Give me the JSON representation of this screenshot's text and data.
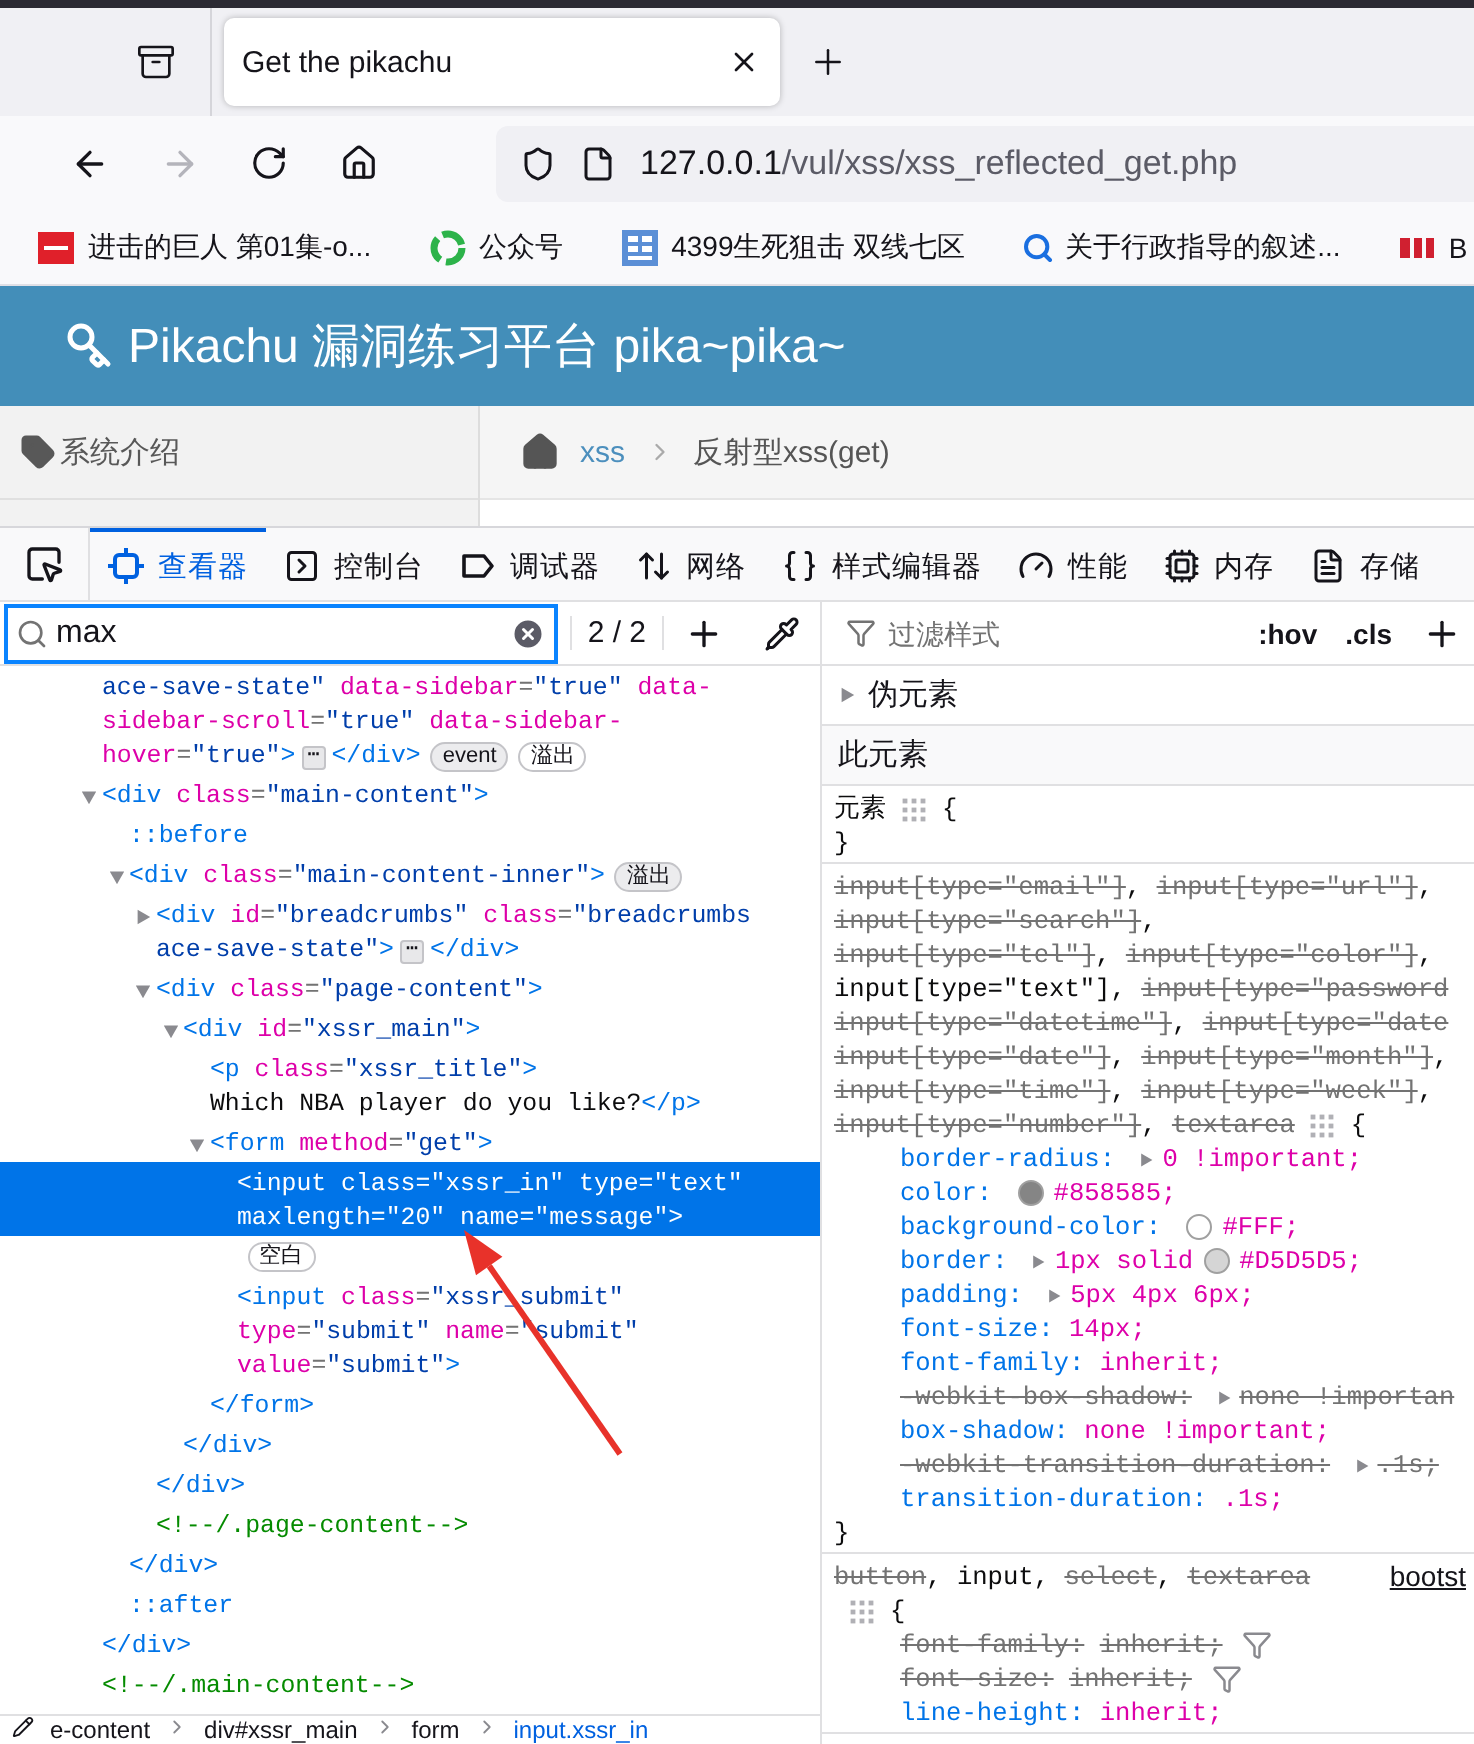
{
  "browser": {
    "tab": {
      "title": "Get the pikachu",
      "selected": true
    },
    "url": {
      "host": "127.0.0.1",
      "path": "/vul/xss/xss_reflected_get.php"
    },
    "forward_disabled": true,
    "bookmarks": [
      {
        "kind": "video",
        "label": "进击的巨人 第01集-o..."
      },
      {
        "kind": "ring",
        "label": "公众号"
      },
      {
        "kind": "grid",
        "label": "4399生死狙击 双线七区"
      },
      {
        "kind": "search",
        "label": "关于行政指导的叙述..."
      },
      {
        "kind": "logo",
        "label": "B"
      }
    ]
  },
  "page": {
    "title": "Pikachu 漏洞练习平台 pika~pika~",
    "sidebar_item": "系统介绍",
    "breadcrumb": [
      {
        "label": "xss",
        "link": true
      },
      {
        "label": "反射型xss(get)",
        "link": false
      }
    ]
  },
  "devtools": {
    "tabs": [
      {
        "label": "查看器",
        "selected": true
      },
      {
        "label": "控制台",
        "selected": false
      },
      {
        "label": "调试器",
        "selected": false
      },
      {
        "label": "网络",
        "selected": false
      },
      {
        "label": "样式编辑器",
        "selected": false
      },
      {
        "label": "性能",
        "selected": false
      },
      {
        "label": "内存",
        "selected": false
      },
      {
        "label": "存储",
        "selected": false
      }
    ],
    "search": {
      "value": "max",
      "count": "2 / 2"
    },
    "markup": [
      {
        "selected": false,
        "lines": [
          [
            {
              "kind": "value",
              "text": "ace-save-state\""
            },
            {
              "kind": "attr",
              "text": " data-sidebar"
            },
            {
              "kind": "punct",
              "text": "="
            },
            {
              "kind": "value",
              "text": "\"true\""
            },
            {
              "kind": "attr",
              "text": " data-"
            }
          ],
          [
            {
              "kind": "attr",
              "text": "sidebar-scroll"
            },
            {
              "kind": "punct",
              "text": "="
            },
            {
              "kind": "value",
              "text": "\"true\""
            },
            {
              "kind": "attr",
              "text": " data-sidebar-"
            }
          ],
          [
            {
              "kind": "attr",
              "text": "hover"
            },
            {
              "kind": "punct",
              "text": "="
            },
            {
              "kind": "value",
              "text": "\"true\""
            },
            {
              "kind": "tag",
              "text": ">"
            },
            {
              "kind": "ellipsis",
              "text": "⋯"
            },
            {
              "kind": "tag",
              "text": "</div>"
            },
            {
              "kind": "badge",
              "text": "event"
            },
            {
              "kind": "badge",
              "text": "溢出"
            }
          ]
        ]
      },
      {
        "selected": false,
        "expanded": true,
        "lines": [
          [
            {
              "kind": "tag",
              "text": "<div"
            },
            {
              "kind": "attr",
              "text": " class"
            },
            {
              "kind": "punct",
              "text": "="
            },
            {
              "kind": "value",
              "text": "\"main-content\""
            },
            {
              "kind": "tag",
              "text": ">"
            }
          ]
        ],
        "close": [
          {
            "kind": "tag",
            "text": "</div>"
          }
        ],
        "children": [
          {
            "selected": false,
            "lines": [
              [
                {
                  "kind": "pseudo",
                  "text": "::before"
                }
              ]
            ]
          },
          {
            "selected": false,
            "expanded": true,
            "lines": [
              [
                {
                  "kind": "tag",
                  "text": "<div"
                },
                {
                  "kind": "attr",
                  "text": " class"
                },
                {
                  "kind": "punct",
                  "text": "="
                },
                {
                  "kind": "value",
                  "text": "\"main-content-inner\""
                },
                {
                  "kind": "tag",
                  "text": ">"
                },
                {
                  "kind": "badge",
                  "text": "溢出"
                }
              ]
            ],
            "close": [
              {
                "kind": "tag",
                "text": "</div>"
              }
            ],
            "children": [
              {
                "selected": false,
                "expanded": false,
                "lines": [
                  [
                    {
                      "kind": "tag",
                      "text": "<div"
                    },
                    {
                      "kind": "attr",
                      "text": " id"
                    },
                    {
                      "kind": "punct",
                      "text": "="
                    },
                    {
                      "kind": "value",
                      "text": "\"breadcrumbs\""
                    },
                    {
                      "kind": "attr",
                      "text": " class"
                    },
                    {
                      "kind": "punct",
                      "text": "="
                    },
                    {
                      "kind": "value",
                      "text": "\"breadcrumbs"
                    }
                  ],
                  [
                    {
                      "kind": "value",
                      "text": "ace-save-state\""
                    },
                    {
                      "kind": "tag",
                      "text": ">"
                    },
                    {
                      "kind": "ellipsis",
                      "text": "⋯"
                    },
                    {
                      "kind": "tag",
                      "text": "</div>"
                    }
                  ]
                ]
              },
              {
                "selected": false,
                "expanded": true,
                "lines": [
                  [
                    {
                      "kind": "tag",
                      "text": "<div"
                    },
                    {
                      "kind": "attr",
                      "text": " class"
                    },
                    {
                      "kind": "punct",
                      "text": "="
                    },
                    {
                      "kind": "value",
                      "text": "\"page-content\""
                    },
                    {
                      "kind": "tag",
                      "text": ">"
                    }
                  ]
                ],
                "close": [
                  {
                    "kind": "tag",
                    "text": "</div>"
                  }
                ],
                "children": [
                  {
                    "selected": false,
                    "expanded": true,
                    "lines": [
                      [
                        {
                          "kind": "tag",
                          "text": "<div"
                        },
                        {
                          "kind": "attr",
                          "text": " id"
                        },
                        {
                          "kind": "punct",
                          "text": "="
                        },
                        {
                          "kind": "value",
                          "text": "\"xssr_main\""
                        },
                        {
                          "kind": "tag",
                          "text": ">"
                        }
                      ]
                    ],
                    "close": [
                      {
                        "kind": "tag",
                        "text": "</div>"
                      }
                    ],
                    "children": [
                      {
                        "selected": false,
                        "lines": [
                          [
                            {
                              "kind": "tag",
                              "text": "<p"
                            },
                            {
                              "kind": "attr",
                              "text": " class"
                            },
                            {
                              "kind": "punct",
                              "text": "="
                            },
                            {
                              "kind": "value",
                              "text": "\"xssr_title\""
                            },
                            {
                              "kind": "tag",
                              "text": ">"
                            }
                          ],
                          [
                            {
                              "kind": "text",
                              "text": "Which NBA player do you like?"
                            },
                            {
                              "kind": "tag",
                              "text": "</p>"
                            }
                          ]
                        ]
                      },
                      {
                        "selected": false,
                        "expanded": true,
                        "lines": [
                          [
                            {
                              "kind": "tag",
                              "text": "<form"
                            },
                            {
                              "kind": "attr",
                              "text": " method"
                            },
                            {
                              "kind": "punct",
                              "text": "="
                            },
                            {
                              "kind": "value",
                              "text": "\"get\""
                            },
                            {
                              "kind": "tag",
                              "text": ">"
                            }
                          ]
                        ],
                        "close": [
                          {
                            "kind": "tag",
                            "text": "</form>"
                          }
                        ],
                        "children": [
                          {
                            "selected": true,
                            "lines": [
                              [
                                {
                                  "kind": "tag",
                                  "text": "<input"
                                },
                                {
                                  "kind": "attr",
                                  "text": " class"
                                },
                                {
                                  "kind": "punct",
                                  "text": "="
                                },
                                {
                                  "kind": "value",
                                  "text": "\"xssr_in\""
                                },
                                {
                                  "kind": "attr",
                                  "text": " type"
                                },
                                {
                                  "kind": "punct",
                                  "text": "="
                                },
                                {
                                  "kind": "value",
                                  "text": "\"text\""
                                }
                              ],
                              [
                                {
                                  "kind": "attr",
                                  "text": "maxlength"
                                },
                                {
                                  "kind": "punct",
                                  "text": "="
                                },
                                {
                                  "kind": "value",
                                  "text": "\"20\""
                                },
                                {
                                  "kind": "attr",
                                  "text": " name"
                                },
                                {
                                  "kind": "punct",
                                  "text": "="
                                },
                                {
                                  "kind": "value",
                                  "text": "\"message\""
                                },
                                {
                                  "kind": "tag",
                                  "text": ">"
                                }
                              ]
                            ]
                          },
                          {
                            "selected": false,
                            "lines": [
                              [
                                {
                                  "kind": "badge",
                                  "text": "空白"
                                }
                              ]
                            ]
                          },
                          {
                            "selected": false,
                            "lines": [
                              [
                                {
                                  "kind": "tag",
                                  "text": "<input"
                                },
                                {
                                  "kind": "attr",
                                  "text": " class"
                                },
                                {
                                  "kind": "punct",
                                  "text": "="
                                },
                                {
                                  "kind": "value",
                                  "text": "\"xssr_submit\""
                                }
                              ],
                              [
                                {
                                  "kind": "attr",
                                  "text": "type"
                                },
                                {
                                  "kind": "punct",
                                  "text": "="
                                },
                                {
                                  "kind": "value",
                                  "text": "\"submit\""
                                },
                                {
                                  "kind": "attr",
                                  "text": " name"
                                },
                                {
                                  "kind": "punct",
                                  "text": "="
                                },
                                {
                                  "kind": "value",
                                  "text": "\"submit\""
                                }
                              ],
                              [
                                {
                                  "kind": "attr",
                                  "text": "value"
                                },
                                {
                                  "kind": "punct",
                                  "text": "="
                                },
                                {
                                  "kind": "value",
                                  "text": "\"submit\""
                                },
                                {
                                  "kind": "tag",
                                  "text": ">"
                                }
                              ]
                            ]
                          }
                        ]
                      }
                    ]
                  }
                ]
              },
              {
                "selected": false,
                "lines": [
                  [
                    {
                      "kind": "comment",
                      "text": "<!--/.page-content-->"
                    }
                  ]
                ]
              }
            ]
          },
          {
            "selected": false,
            "lines": [
              [
                {
                  "kind": "pseudo",
                  "text": "::after"
                }
              ]
            ]
          }
        ]
      },
      {
        "selected": false,
        "lines": [
          [
            {
              "kind": "comment",
              "text": "<!--/.main-content-->"
            }
          ]
        ]
      }
    ],
    "path": [
      {
        "label": "e-content",
        "selected": false
      },
      {
        "label": "div#xssr_main",
        "selected": false
      },
      {
        "label": "form",
        "selected": false
      },
      {
        "label": "input.xssr_in",
        "selected": true
      }
    ],
    "styles": {
      "filter_placeholder": "过滤样式",
      "buttons": [
        ":hov",
        ".cls"
      ],
      "pseudo_section": {
        "label": "伪元素",
        "expanded": false
      },
      "this_element": "此元素",
      "rules": [
        {
          "selector_lines": [
            [
              {
                "text": "元素",
                "struck": false
              }
            ]
          ],
          "open": "{",
          "close": "}"
        },
        {
          "selector_lines": [
            [
              {
                "text": "input[type=\"email\"]",
                "struck": true
              },
              {
                "text": ", ",
                "struck": false
              },
              {
                "text": "input[type=\"url\"]",
                "struck": true
              },
              {
                "text": ",",
                "struck": false
              }
            ],
            [
              {
                "text": "input[type=\"search\"]",
                "struck": true
              },
              {
                "text": ",",
                "struck": false
              }
            ],
            [
              {
                "text": "input[type=\"tel\"]",
                "struck": true
              },
              {
                "text": ", ",
                "struck": false
              },
              {
                "text": "input[type=\"color\"]",
                "struck": true
              },
              {
                "text": ",",
                "struck": false
              }
            ],
            [
              {
                "text": "input[type=\"text\"]",
                "struck": false
              },
              {
                "text": ", ",
                "struck": false
              },
              {
                "text": "input[type=\"password",
                "struck": true
              }
            ],
            [
              {
                "text": "input[type=\"datetime\"]",
                "struck": true
              },
              {
                "text": ", ",
                "struck": false
              },
              {
                "text": "input[type=\"date",
                "struck": true
              }
            ],
            [
              {
                "text": "input[type=\"date\"]",
                "struck": true
              },
              {
                "text": ", ",
                "struck": false
              },
              {
                "text": "input[type=\"month\"]",
                "struck": true
              },
              {
                "text": ",",
                "struck": false
              }
            ],
            [
              {
                "text": "input[type=\"time\"]",
                "struck": true
              },
              {
                "text": ", ",
                "struck": false
              },
              {
                "text": "input[type=\"week\"]",
                "struck": true
              },
              {
                "text": ",",
                "struck": false
              }
            ],
            [
              {
                "text": "input[type=\"number\"]",
                "struck": true
              },
              {
                "text": ", ",
                "struck": false
              },
              {
                "text": "textarea",
                "struck": true
              }
            ]
          ],
          "open": "{",
          "close": "}",
          "declarations": [
            {
              "property": "border-radius:",
              "expander": true,
              "value": "0 !important;",
              "struck": false
            },
            {
              "property": "color:",
              "color": "#858585",
              "value": "#858585;",
              "struck": false
            },
            {
              "property": "background-color:",
              "color": "#ffffff",
              "value": "#FFF;",
              "struck": false
            },
            {
              "property": "border:",
              "expander": true,
              "pre": "1px solid",
              "color": "#d5d5d5",
              "value": "#D5D5D5;",
              "struck": false
            },
            {
              "property": "padding:",
              "expander": true,
              "value": "5px 4px 6px;",
              "struck": false
            },
            {
              "property": "font-size:",
              "value": "14px;",
              "struck": false
            },
            {
              "property": "font-family:",
              "value": "inherit;",
              "struck": false
            },
            {
              "property": "-webkit-box-shadow:",
              "expander": true,
              "value": "none !importan",
              "struck": true
            },
            {
              "property": "box-shadow:",
              "value": "none !important;",
              "struck": false
            },
            {
              "property": "-webkit-transition-duration:",
              "expander": true,
              "value": ".1s;",
              "struck": true
            },
            {
              "property": "transition-duration:",
              "value": ".1s;",
              "struck": false
            }
          ]
        },
        {
          "selector_lines": [
            [
              {
                "text": "button",
                "struck": true
              },
              {
                "text": ", ",
                "struck": false
              },
              {
                "text": "input",
                "struck": false
              },
              {
                "text": ", ",
                "struck": false
              },
              {
                "text": "select",
                "struck": true
              },
              {
                "text": ", ",
                "struck": false
              },
              {
                "text": "textarea",
                "struck": true
              }
            ]
          ],
          "source": "bootst",
          "open": "{",
          "declarations": [
            {
              "property": "font-family:",
              "value": "inherit;",
              "struck": true,
              "filtered": true
            },
            {
              "property": "font-size:",
              "value": "inherit;",
              "struck": true,
              "filtered": true
            },
            {
              "property": "line-height:",
              "value": "inherit;",
              "struck": false
            }
          ]
        }
      ]
    }
  }
}
